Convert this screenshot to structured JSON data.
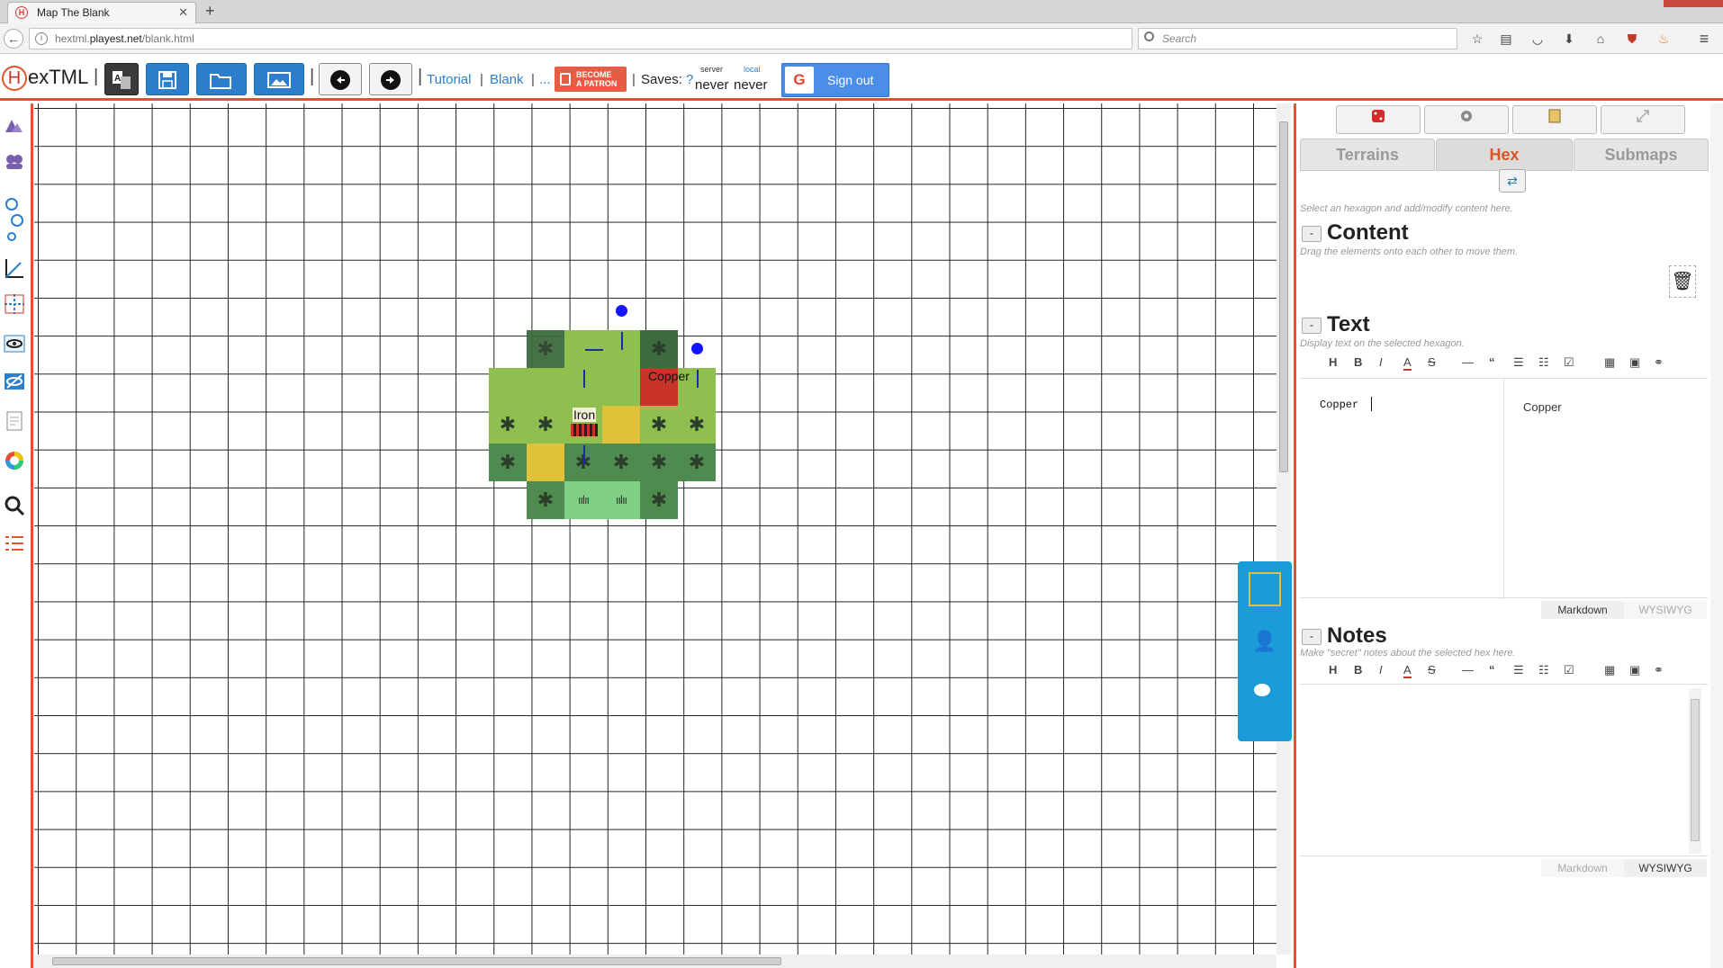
{
  "browser": {
    "tab_title": "Map The Blank",
    "tab_icon_letter": "H",
    "url_host": "hextml.",
    "url_domain": "playest.net",
    "url_path": "/blank.html",
    "search_placeholder": "Search"
  },
  "app": {
    "logo_letter": "H",
    "logo_rest": "exTML",
    "links": {
      "tutorial": "Tutorial",
      "blank": "Blank",
      "more": "..."
    },
    "patron_label_1": "BECOME",
    "patron_label_2": "A PATRON",
    "saves_label": "Saves:",
    "saves_help": "?",
    "server_label": "server",
    "local_label": "local",
    "server_value": "never",
    "local_value": "never",
    "sign_label": "Sign out",
    "google_letter": "G",
    "accent_color": "#e2542b",
    "button_color": "#2b7fcc"
  },
  "map": {
    "labels": {
      "copper": "Copper",
      "iron": "Iron"
    },
    "terrain_colors": {
      "jungle": "#4f8a4f",
      "grassland": "#8fbf4f",
      "desert": "#e0c23a",
      "forest_dark": "#3d6b3d",
      "steppe": "#7fcf87",
      "copper": "#c8332a"
    }
  },
  "panel": {
    "tabs": [
      "Terrains",
      "Hex",
      "Submaps"
    ],
    "active_tab": "Hex",
    "intro_hint": "Select an hexagon and add/modify content here.",
    "content": {
      "title": "Content",
      "hint": "Drag the elements onto each other to move them.",
      "collapse": "-"
    },
    "text": {
      "title": "Text",
      "hint": "Display text on the selected hexagon.",
      "collapse": "-",
      "editor_value": "Copper",
      "preview_value": "Copper",
      "mode_markdown": "Markdown",
      "mode_wysiwyg": "WYSIWYG"
    },
    "notes": {
      "title": "Notes",
      "hint": "Make \"secret\" notes about the selected hex here.",
      "collapse": "-",
      "mode_markdown": "Markdown",
      "mode_wysiwyg": "WYSIWYG"
    },
    "toolbar_items": [
      "H",
      "B",
      "I",
      "A",
      "S",
      "—",
      "“",
      "•",
      "1.",
      "☑",
      "▦",
      "▣",
      "⚭"
    ]
  }
}
